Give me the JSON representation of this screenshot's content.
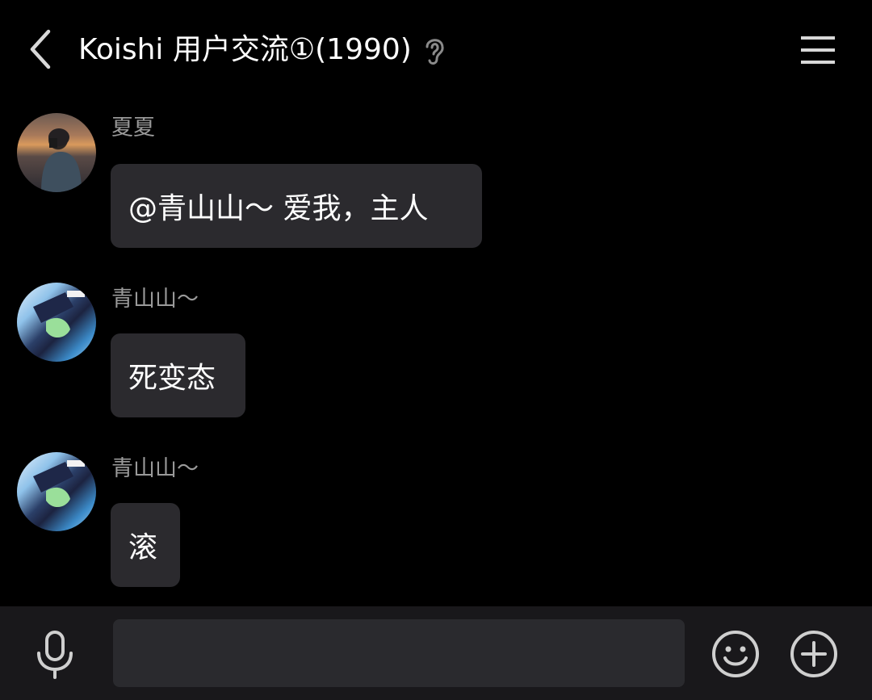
{
  "header": {
    "title": "Koishi 用户交流①(1990)",
    "back_icon": "chevron-left-icon",
    "ear_icon": "ear-icon",
    "menu_icon": "hamburger-menu-icon"
  },
  "messages": [
    {
      "sender": "夏夏",
      "text": "@青山山〜 爱我，主人"
    },
    {
      "sender": "青山山〜",
      "text": "死变态"
    },
    {
      "sender": "青山山〜",
      "text": "滚"
    }
  ],
  "input_bar": {
    "voice_icon": "microphone-icon",
    "input_value": "",
    "placeholder": "",
    "emoji_icon": "smiley-face-icon",
    "more_icon": "plus-circle-icon"
  },
  "colors": {
    "background": "#000000",
    "bubble": "#2b2a2e",
    "sender_text": "#9a9a9a",
    "input_bar": "#19181b"
  }
}
